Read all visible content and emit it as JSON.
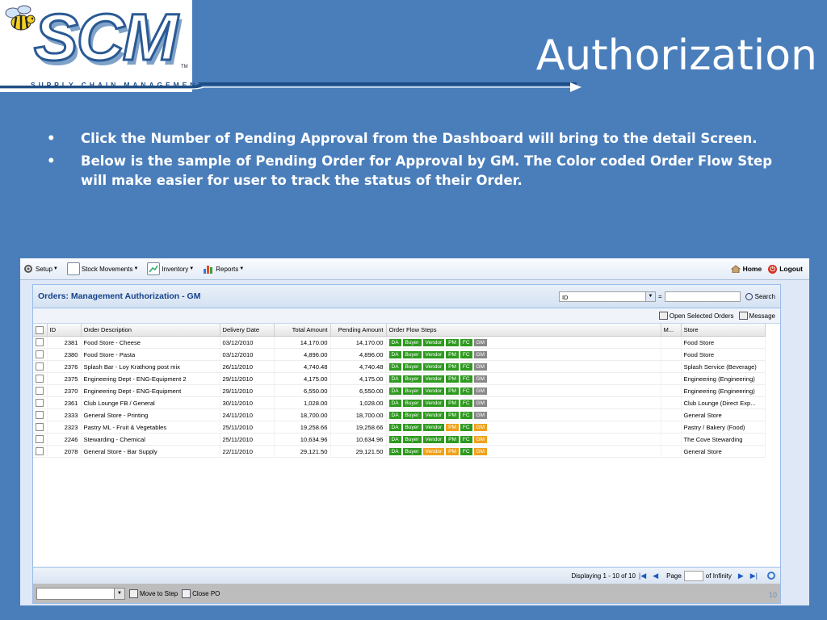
{
  "slide": {
    "title": "Authorization",
    "logo": {
      "text": "SCM",
      "tm": "TM",
      "subtitle": "SUPPLY CHAIN MANAGEMENT"
    },
    "bullets": [
      "Click the Number of Pending Approval from the Dashboard will bring to the detail Screen.",
      "Below is the sample of Pending Order for Approval by GM. The Color coded Order Flow Step will make easier for user to track the status of their Order."
    ],
    "page_number": "10"
  },
  "colors": {
    "slide_bg": "#4a7ebb",
    "step_done": "#2e9a1f",
    "step_pending": "#f0a21a",
    "step_inactive": "#888888",
    "panel_title": "#15428b"
  },
  "topbar": {
    "menus": [
      {
        "label": "Setup",
        "icon": "gear-icon"
      },
      {
        "label": "Stock Movements",
        "icon": "document-icon"
      },
      {
        "label": "Inventory",
        "icon": "chart-icon"
      },
      {
        "label": "Reports",
        "icon": "reports-icon"
      }
    ],
    "home_label": "Home",
    "logout_label": "Logout"
  },
  "panel": {
    "title": "Orders: Management Authorization - GM",
    "filter_field": "ID",
    "filter_operator": "=",
    "filter_value": "",
    "search_label": "Search",
    "open_selected_label": "Open Selected Orders",
    "message_label": "Message"
  },
  "grid": {
    "columns": [
      "ID",
      "Order Description",
      "Delivery Date",
      "Total Amount",
      "Pending Amount",
      "Order Flow Steps",
      "M...",
      "Store"
    ],
    "step_labels": [
      "DA",
      "Buyer",
      "Vendor",
      "PM",
      "FC",
      "GM"
    ],
    "rows": [
      {
        "id": "2381",
        "desc": "Food Store - Cheese",
        "date": "03/12/2010",
        "total": "14,170.00",
        "pending": "14,170.00",
        "steps": [
          "done",
          "done",
          "done",
          "done",
          "done",
          "none"
        ],
        "store": "Food Store"
      },
      {
        "id": "2380",
        "desc": "Food Store - Pasta",
        "date": "03/12/2010",
        "total": "4,896.00",
        "pending": "4,896.00",
        "steps": [
          "done",
          "done",
          "done",
          "done",
          "done",
          "none"
        ],
        "store": "Food Store"
      },
      {
        "id": "2376",
        "desc": "Splash Bar - Loy Krathong post mix",
        "date": "26/11/2010",
        "total": "4,740.48",
        "pending": "4,740.48",
        "steps": [
          "done",
          "done",
          "done",
          "done",
          "done",
          "none"
        ],
        "store": "Splash Service (Beverage)"
      },
      {
        "id": "2375",
        "desc": "Engineering Dept - ENG-Equipment 2",
        "date": "29/11/2010",
        "total": "4,175.00",
        "pending": "4,175.00",
        "steps": [
          "done",
          "done",
          "done",
          "done",
          "done",
          "none"
        ],
        "store": "Engineering (Engineering)"
      },
      {
        "id": "2370",
        "desc": "Engineering Dept - ENG-Equipment",
        "date": "29/11/2010",
        "total": "6,550.00",
        "pending": "6,550.00",
        "steps": [
          "done",
          "done",
          "done",
          "done",
          "done",
          "none"
        ],
        "store": "Engineering (Engineering)"
      },
      {
        "id": "2361",
        "desc": "Club Lounge FB / General",
        "date": "30/11/2010",
        "total": "1,028.00",
        "pending": "1,028.00",
        "steps": [
          "done",
          "done",
          "done",
          "done",
          "done",
          "none"
        ],
        "store": "Club Lounge (Direct Exp..."
      },
      {
        "id": "2333",
        "desc": "General Store - Printing",
        "date": "24/11/2010",
        "total": "18,700.00",
        "pending": "18,700.00",
        "steps": [
          "done",
          "done",
          "done",
          "done",
          "done",
          "none"
        ],
        "store": "General Store"
      },
      {
        "id": "2323",
        "desc": "Pastry ML - Fruit & Vegetables",
        "date": "25/11/2010",
        "total": "19,258.66",
        "pending": "19,258.66",
        "steps": [
          "done",
          "done",
          "done",
          "pending",
          "done",
          "pending"
        ],
        "store": "Pastry / Bakery (Food)"
      },
      {
        "id": "2246",
        "desc": "Stewarding - Chemical",
        "date": "25/11/2010",
        "total": "10,634.96",
        "pending": "10,634.96",
        "steps": [
          "done",
          "done",
          "done",
          "done",
          "done",
          "pending"
        ],
        "store": "The Cove Stewarding"
      },
      {
        "id": "2078",
        "desc": "General Store - Bar Supply",
        "date": "22/11/2010",
        "total": "29,121.50",
        "pending": "29,121.50",
        "steps": [
          "done",
          "done",
          "pending",
          "pending",
          "done",
          "pending"
        ],
        "store": "General Store"
      }
    ]
  },
  "pager": {
    "displaying": "Displaying 1 - 10 of 10",
    "page_label": "Page",
    "page_value": "",
    "of_label": "of Infinity"
  },
  "bottom": {
    "action_value": "",
    "move_label": "Move to Step",
    "close_label": "Close PO"
  }
}
